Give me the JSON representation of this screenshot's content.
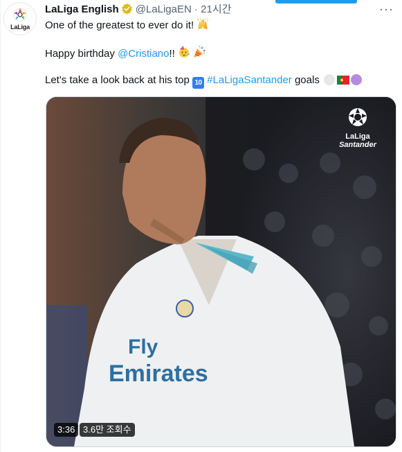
{
  "account": {
    "display_name": "LaLiga English",
    "handle": "@LaLigaEN",
    "separator": "·",
    "time_ago": "21시간",
    "avatar_text": "LaLiga",
    "verified_icon": "gold-verified-badge"
  },
  "tweet": {
    "line1_text": "One of the greatest to ever do it!",
    "line2_prefix": "Happy birthday",
    "line2_mention": "@Cristiano",
    "line2_bangs": "!!",
    "line3_prefix": "Let's take a look back at his top",
    "line3_keycap": "10",
    "line3_hashtag": "#LaLigaSantander",
    "line3_suffix": "goals",
    "emojis": [
      "raising-hands",
      "party-face",
      "party-popper",
      "ball-circle",
      "portugal-flag",
      "purple-circle"
    ]
  },
  "video": {
    "duration": "3:36",
    "views": "3.6만 조회수",
    "watermark_line1": "LaLiga",
    "watermark_line2": "Santander",
    "shirt_text_1": "Fly",
    "shirt_text_2": "Emirates"
  },
  "colors": {
    "link": "#1d9bf0",
    "text": "#0f1419",
    "meta": "#536471",
    "verified": "#e2b719"
  }
}
